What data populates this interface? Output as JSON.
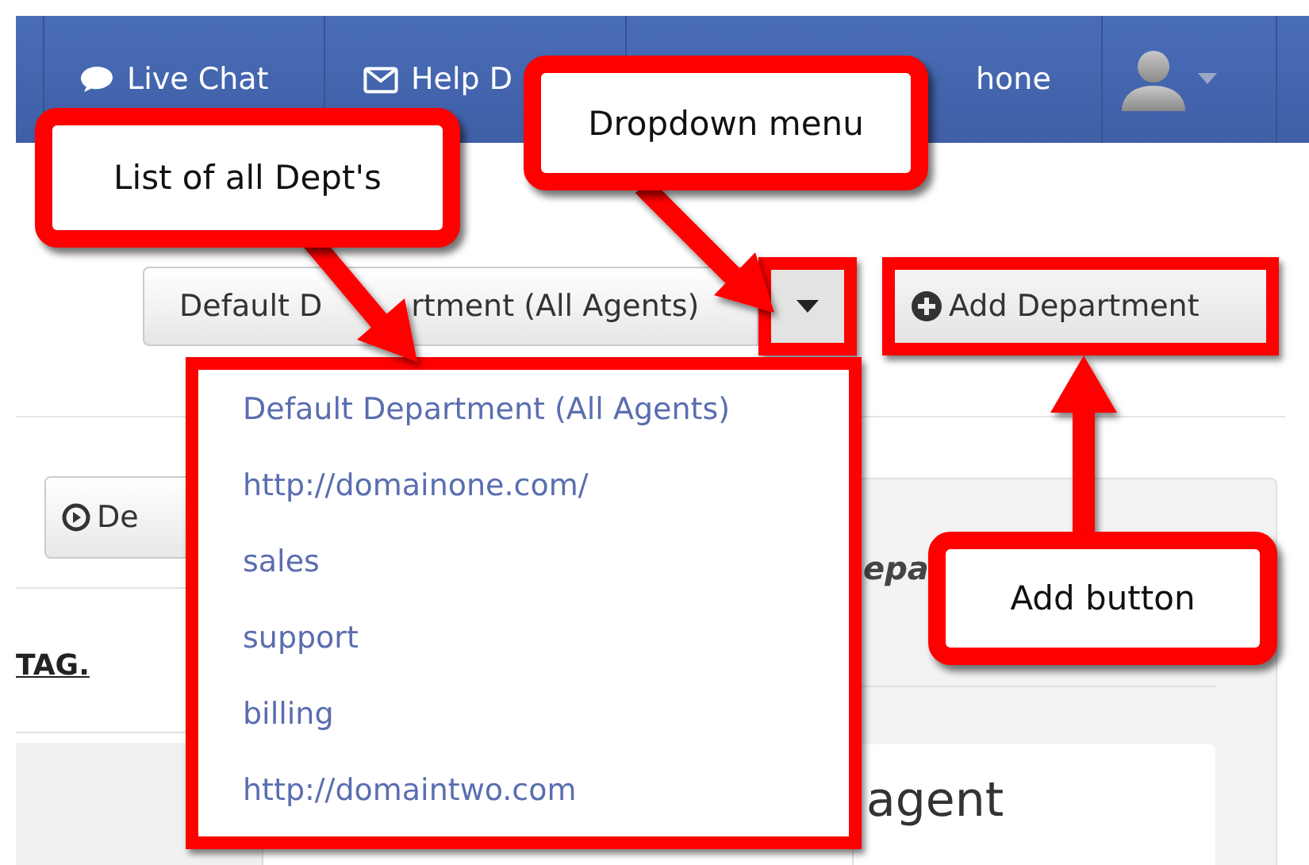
{
  "nav": {
    "items": [
      {
        "label": "Live Chat",
        "kind": "chat"
      },
      {
        "label": "Help D",
        "kind": "mail"
      },
      {
        "label": "hone",
        "kind": "text"
      }
    ]
  },
  "department_select": {
    "label_parts": [
      "Default D",
      "rtment (All Agents)"
    ]
  },
  "add_button": {
    "label": "Add Department"
  },
  "demo_button": {
    "label": "De"
  },
  "tag_link": "TAG.",
  "panel_heading": "epa",
  "card_title": "agent",
  "dropdown": {
    "items": [
      {
        "label": "Default Department (All Agents)"
      },
      {
        "label": "http://domainone.com/"
      },
      {
        "label": "sales"
      },
      {
        "label": "support"
      },
      {
        "label": "billing"
      },
      {
        "label": "http://domaintwo.com"
      }
    ]
  },
  "annotations": [
    {
      "text": "List of all Dept's"
    },
    {
      "text": "Dropdown menu"
    },
    {
      "text": "Add button"
    }
  ]
}
